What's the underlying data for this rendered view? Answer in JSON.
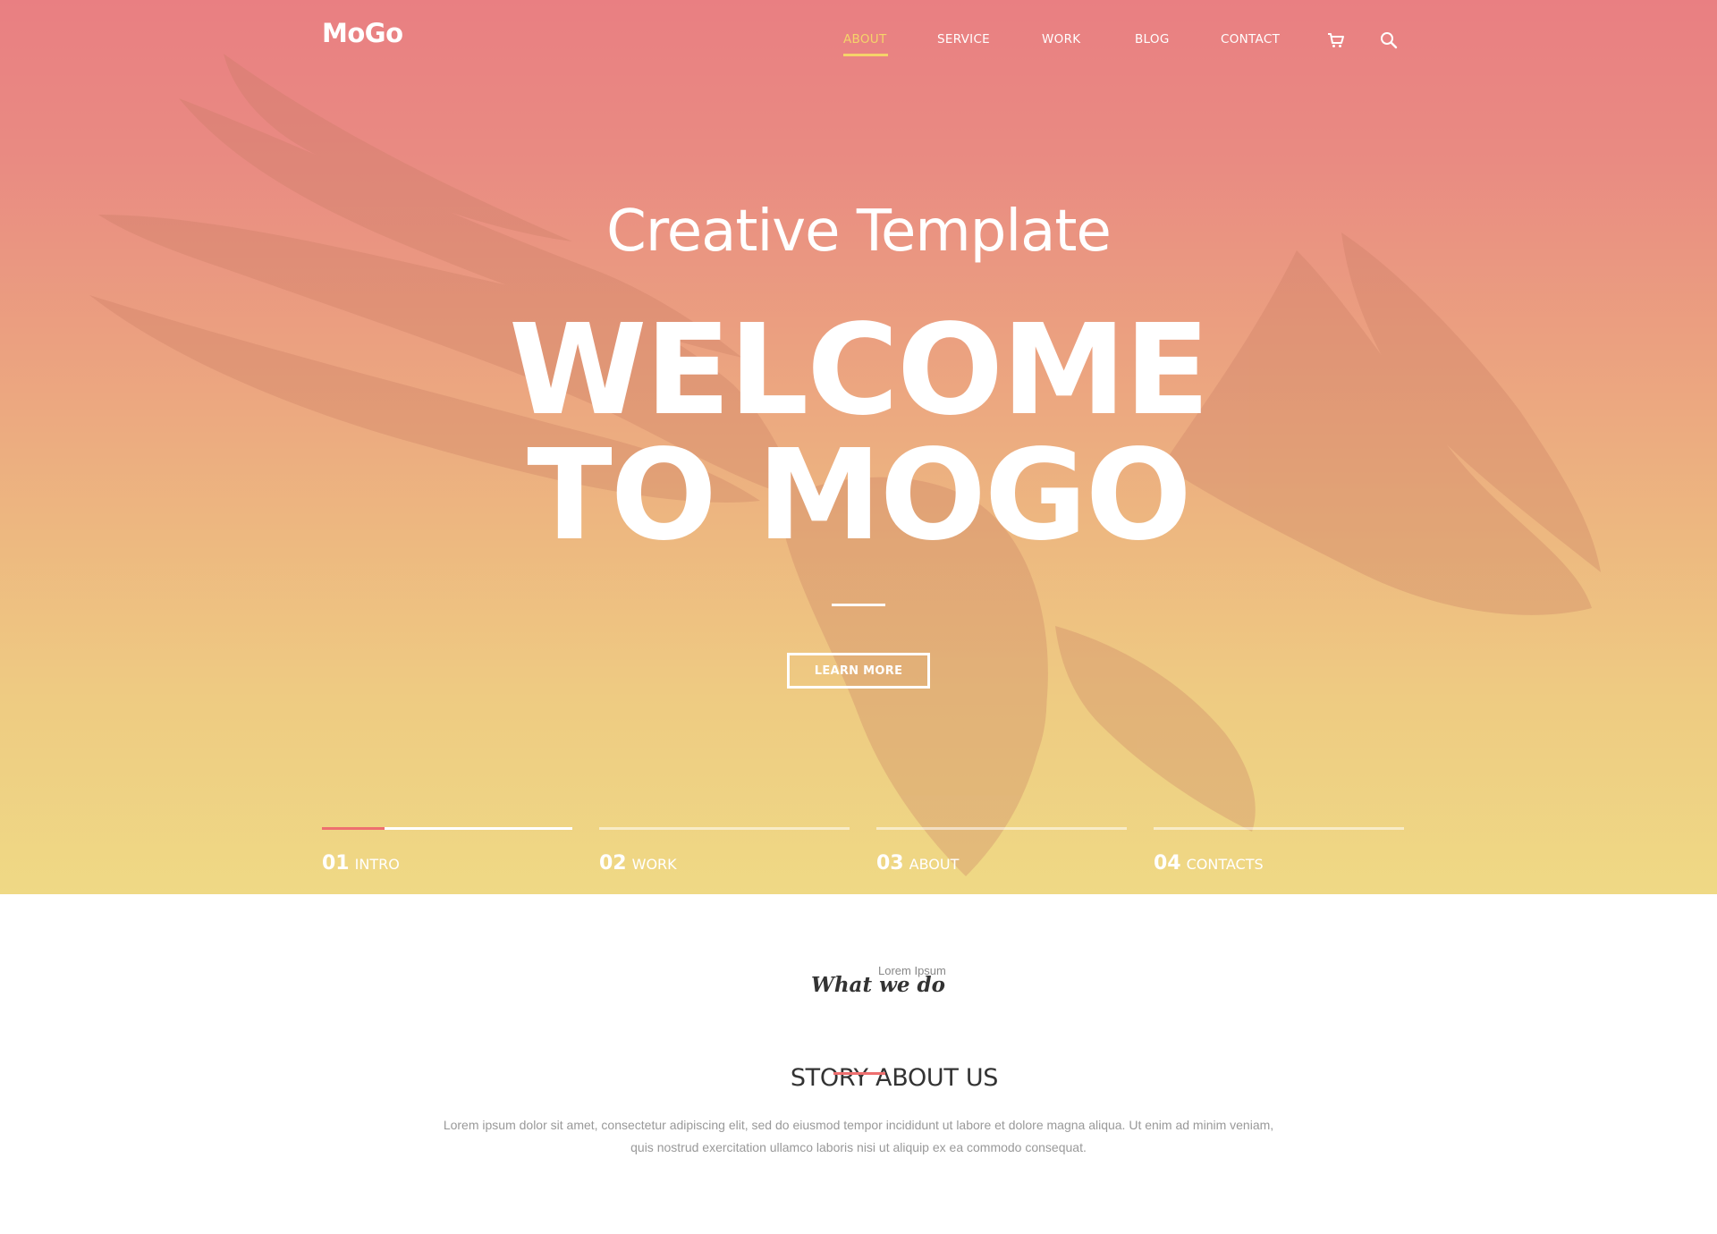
{
  "brand": {
    "logo": "MoGo"
  },
  "nav": {
    "items": [
      {
        "label": "ABOUT",
        "active": true
      },
      {
        "label": "SERVICE",
        "active": false
      },
      {
        "label": "WORK",
        "active": false
      },
      {
        "label": "BLOG",
        "active": false
      },
      {
        "label": "CONTACT",
        "active": false
      }
    ],
    "icons": [
      "cart-icon",
      "search-icon"
    ]
  },
  "hero": {
    "subtitle": "Creative Template",
    "headline_line1": "WELCOME",
    "headline_line2": "TO MOGO",
    "button_label": "LEARN MORE"
  },
  "slider": {
    "tabs": [
      {
        "number": "01",
        "label": "INTRO",
        "progress": 0.25
      },
      {
        "number": "02",
        "label": "WORK",
        "progress": 0
      },
      {
        "number": "03",
        "label": "ABOUT",
        "progress": 0
      },
      {
        "number": "04",
        "label": "CONTACTS",
        "progress": 0
      }
    ]
  },
  "section": {
    "script_heading": "What we do",
    "small_label": "Lorem Ipsum",
    "title": "STORY ABOUT US",
    "description_line1": "Lorem ipsum dolor sit amet, consectetur adipiscing elit, sed do eiusmod tempor incididunt ut labore et dolore magna aliqua. Ut enim ad minim veniam,",
    "description_line2": "quis nostrud exercitation ullamco laboris nisi ut aliquip ex ea commodo consequat."
  },
  "colors": {
    "accent_yellow": "#f5d46a",
    "accent_red": "#ee6f6f",
    "gradient_top": "#e97f82",
    "gradient_bottom": "#efd985"
  }
}
